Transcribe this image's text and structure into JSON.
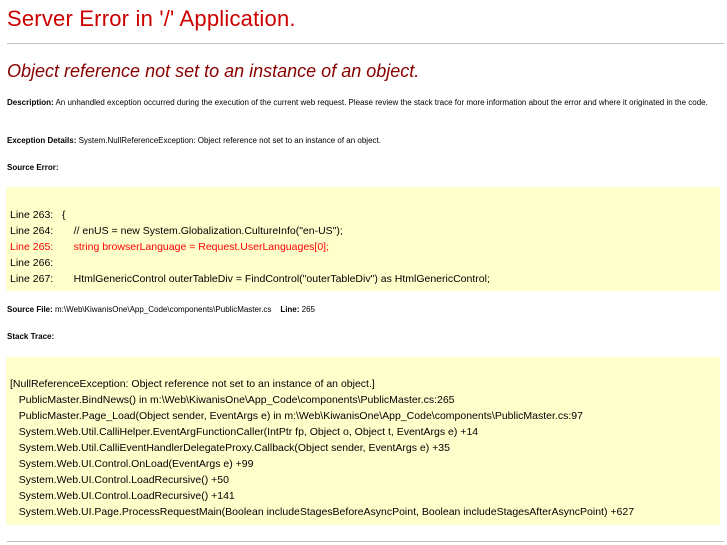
{
  "title": "Server Error in '/' Application.",
  "subtitle": "Object reference not set to an instance of an object.",
  "description": {
    "label": "Description:",
    "text": " An unhandled exception occurred during the execution of the current web request. Please review the stack trace for more information about the error and where it originated in the code."
  },
  "exception": {
    "label": "Exception Details:",
    "text": " System.NullReferenceException: Object reference not set to an instance of an object."
  },
  "source_error": {
    "label": "Source Error:",
    "lines": [
      "Line 263:   {",
      "Line 264:       // enUS = new System.Globalization.CultureInfo(\"en-US\");",
      "Line 265:       string browserLanguage = Request.UserLanguages[0];",
      "Line 266:",
      "Line 267:       HtmlGenericControl outerTableDiv = FindControl(\"outerTableDiv\") as HtmlGenericControl;"
    ]
  },
  "source_file": {
    "label": "Source File:",
    "path": " m:\\Web\\KiwanisOne\\App_Code\\components\\PublicMaster.cs",
    "line_label": "Line:",
    "line_value": " 265"
  },
  "stack_trace": {
    "label": "Stack Trace:",
    "lines": [
      "[NullReferenceException: Object reference not set to an instance of an object.]",
      "   PublicMaster.BindNews() in m:\\Web\\KiwanisOne\\App_Code\\components\\PublicMaster.cs:265",
      "   PublicMaster.Page_Load(Object sender, EventArgs e) in m:\\Web\\KiwanisOne\\App_Code\\components\\PublicMaster.cs:97",
      "   System.Web.Util.CalliHelper.EventArgFunctionCaller(IntPtr fp, Object o, Object t, EventArgs e) +14",
      "   System.Web.Util.CalliEventHandlerDelegateProxy.Callback(Object sender, EventArgs e) +35",
      "   System.Web.UI.Control.OnLoad(EventArgs e) +99",
      "   System.Web.UI.Control.LoadRecursive() +50",
      "   System.Web.UI.Control.LoadRecursive() +141",
      "   System.Web.UI.Page.ProcessRequestMain(Boolean includeStagesBeforeAsyncPoint, Boolean includeStagesAfterAsyncPoint) +627"
    ]
  },
  "colors": {
    "title": "#cc0000",
    "subtitle": "#880000",
    "code_background": "#ffffcc",
    "error_line": "#ff0000"
  }
}
